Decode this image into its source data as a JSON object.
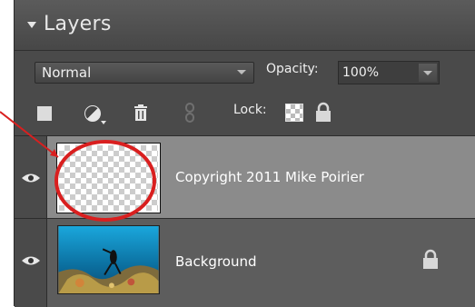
{
  "panel": {
    "title": "Layers",
    "blend_mode": "Normal",
    "opacity_label": "Opacity:",
    "opacity_value": "100%",
    "lock_label": "Lock:"
  },
  "layers": [
    {
      "name": "Copyright 2011 Mike Poirier",
      "visible": true,
      "selected": true
    },
    {
      "name": "Background",
      "visible": true,
      "locked": true
    }
  ],
  "icons": {
    "collapse": "triangle-down-icon",
    "new_layer": "new-layer-icon",
    "adjustment": "adjustment-layer-icon",
    "trash": "trash-icon",
    "link": "link-icon",
    "lock_transparency": "lock-transparency-icon",
    "lock_all": "lock-all-icon",
    "eye": "eye-icon"
  },
  "colors": {
    "panel_bg": "#4a4a4a",
    "selected_row": "#8b8b8b",
    "annotation_red": "#d91f1f"
  }
}
